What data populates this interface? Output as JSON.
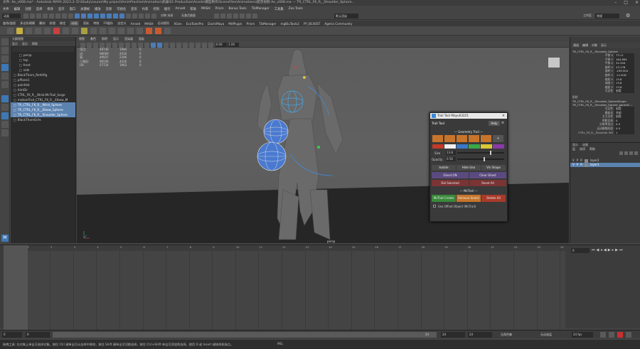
{
  "window": {
    "title": "文件: Ae_v008.ma* - Autodesk MAYA 2023.3: D:\\Study\\course\\My project\\AnimPractise\\Animation\\武器\\01 Production\\Assets\\模型制作\\SceneFiles\\Animations\\配音视频 Ae_v008.ma --- TR_CTRL_FK_R__Shoulder_Sphere..."
  },
  "menubar": [
    "文件",
    "编辑",
    "创建",
    "选择",
    "修改",
    "显示",
    "窗口",
    "关键帧",
    "播放",
    "音频",
    "可视化",
    "变形",
    "约束",
    "控制",
    "缓存",
    "Arnold",
    "帮助",
    "MASH",
    "Prism",
    "Bonus Tools",
    "TikManager",
    "工具集",
    "Zoo Tools"
  ],
  "workspace": {
    "label": "工作区:",
    "value": "常规"
  },
  "statusline": {
    "mode": "动画",
    "symmetry": "对称:关闭",
    "no_live": "无激活曲面",
    "render_preset": "默认渲染"
  },
  "shelf_tabs": [
    "曲线/曲面",
    "多边形建模",
    "雕刻",
    "纹理",
    "绑定",
    "动画",
    "渲染",
    "特效",
    "FX缓存",
    "自定义",
    "Arnold",
    "MASH",
    "运动图形",
    "XGen",
    "EcoToolsPro",
    "DachiMaya",
    "MitPlugin",
    "Prism",
    "TikManager",
    "mgBiuTools2",
    "PY_BC4SST",
    "Ageria Community"
  ],
  "outliner": {
    "header": "大纲视图",
    "menu": [
      "显示",
      "显示",
      "帮助"
    ],
    "items": [
      {
        "label": "persp",
        "sel": false,
        "indent": 1
      },
      {
        "label": "top",
        "sel": false,
        "indent": 1
      },
      {
        "label": "front",
        "sel": false,
        "indent": 1
      },
      {
        "label": "side",
        "sel": false,
        "indent": 1
      },
      {
        "label": "BlackThorn_Rehitfig",
        "sel": false,
        "indent": 0
      },
      {
        "label": "pPlane1",
        "sel": false,
        "indent": 0
      },
      {
        "label": "pointlist",
        "sel": false,
        "indent": 0
      },
      {
        "label": "AimDir",
        "sel": false,
        "indent": 0
      },
      {
        "label": "CTRL_FK_R__Wrist.McTrail_targe",
        "sel": false,
        "indent": 0
      },
      {
        "label": "motionTrail_CTRL_FK_R__Elbow_M",
        "sel": false,
        "indent": 0
      },
      {
        "label": "TR_CTRL_FK_R__Wrist_Sphere",
        "sel": true,
        "indent": 0
      },
      {
        "label": "TR_CTRL_FK_R__Elbow_Sphere",
        "sel": true,
        "indent": 0
      },
      {
        "label": "TR_CTRL_FK_R__Shoulder_Sphere",
        "sel": true,
        "indent": 0
      },
      {
        "label": "BlackThornGirls",
        "sel": false,
        "indent": 0
      }
    ]
  },
  "viewport": {
    "menu": [
      "视图",
      "着色",
      "照明",
      "显示",
      "渲染器",
      "面板"
    ],
    "hud_rows": [
      [
        "顶点:",
        "48739",
        "1994",
        "0"
      ],
      [
        "边:",
        "98669",
        "4416",
        "0"
      ],
      [
        "面:",
        "49937",
        "2396",
        "0"
      ],
      [
        "三角形:",
        "96556",
        "4416",
        "0"
      ],
      [
        "UV:",
        "57724",
        "1963",
        "0"
      ]
    ],
    "camera_label": "persp",
    "fields": [
      "0.00",
      "1.00"
    ]
  },
  "trail_tool": {
    "window_title": "Trail Tool Mayu03221",
    "header": "Trail Tool",
    "help_label": "Help",
    "geometry_trail_label": "--- Geometry Trail ---",
    "color_swatches": [
      "#c23a2a",
      "#f0f0f0",
      "#3a78c8",
      "#3aa848",
      "#d8c838",
      "#8a3aa8"
    ],
    "size_label": "Size",
    "size_value": "13.8",
    "opacity_label": "Opacity",
    "opacity_value": "0.56",
    "isolate": "Isolate",
    "hide_geo": "Hide Geo",
    "vis_shape": "Vis Shape",
    "ghost_on": "Ghost ON",
    "clear_ghost": "Clear Ghost",
    "del_selected": "Del Selected",
    "reset_all": "Reset All",
    "mctrail_label": "--- McTrail ---",
    "mctrail_create": "McTrail Create ",
    "remove_select": "Remove Select",
    "delete_all": "Delete All",
    "offset_label": "Use Offset Object (McTrail)"
  },
  "channel_box": {
    "tabs": [
      "通道",
      "编辑",
      "对象",
      "显示"
    ],
    "object": "TR_CTRL_FK_R__Shoulder_Sphere",
    "attrs": [
      [
        "平移 X",
        "73.11"
      ],
      [
        "平移 Y",
        "164.694"
      ],
      [
        "平移 Z",
        "32.294"
      ],
      [
        "旋转 X",
        "23.178"
      ],
      [
        "旋转 Y",
        "-199.504"
      ],
      [
        "旋转 Z",
        "-11.818"
      ],
      [
        "缩放 X",
        "13.8"
      ],
      [
        "缩放 Y",
        "13.8"
      ],
      [
        "缩放 Z",
        "13.8"
      ],
      [
        "可见性",
        "启用"
      ]
    ],
    "shapes_label": "形状",
    "shapes": [
      "TR_CTRL_FK_R__Shoulder_SphereShape",
      "TR_CTRL_FK_R__Shoulder_Sphere_parentC..."
    ],
    "shape_attrs": [
      [
        "可见性",
        "启用"
      ],
      [
        "模板化",
        "关闭"
      ],
      [
        "主可见性",
        "启用"
      ],
      [
        "阴影实体",
        "0"
      ],
      [
        "分辨率拐点",
        "0.5"
      ],
      [
        "运动模糊局部",
        "0.5"
      ],
      [
        "CTRL_FK_R__Shoulder W0",
        "1"
      ]
    ],
    "layer_tabs": [
      "显示",
      "动画"
    ],
    "layer_menu": [
      "层",
      "选项",
      "帮助"
    ],
    "layers": [
      {
        "name": "layer2",
        "sel": false
      },
      {
        "name": "layer1",
        "sel": true
      }
    ]
  },
  "timeline": {
    "ticks": [
      "0",
      "1",
      "2",
      "3",
      "4",
      "5",
      "6",
      "7",
      "8",
      "9",
      "10",
      "11",
      "12",
      "13",
      "14",
      "15",
      "16",
      "17",
      "18",
      "19",
      "20",
      "21",
      "22",
      "23",
      "24"
    ],
    "current_frame": "0"
  },
  "range": {
    "start": "0",
    "inner_start": "0",
    "inner_end": "24",
    "end": "24",
    "end2": "24",
    "anim_layer": "无角色集",
    "char": "无动画层",
    "fps": "24 fps"
  },
  "help_line": "拖拽工具: 在对象上单击可选择对象。按住 Ctrl 键单击可从选择中移除。按住 Shift 键单击可切换选择。按住 Ctrl+Shift 单击可添加到选择。使用 D 或 Insert 键修改枢轴点。",
  "mel_label": "MEL",
  "colors": {
    "accent": "#5c82b0",
    "purple_btn": "#5a4a80",
    "red_btn": "#7a3434",
    "green_btn": "#3a8a3a",
    "orange_btn": "#c8742a",
    "darkred_btn": "#a83a2a"
  }
}
